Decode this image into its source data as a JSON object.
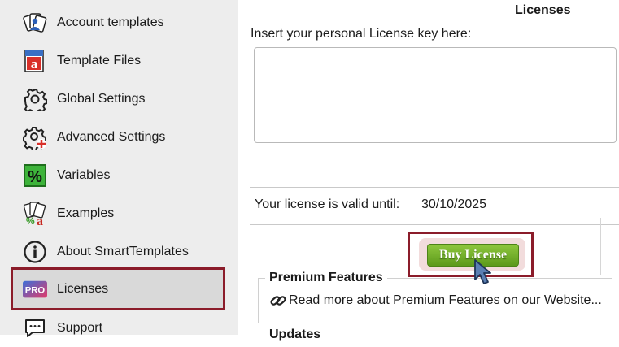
{
  "sidebar": {
    "items": [
      {
        "label": "Account templates",
        "icon": "account-templates-icon"
      },
      {
        "label": "Template Files",
        "icon": "template-files-icon"
      },
      {
        "label": "Global Settings",
        "icon": "gear-icon"
      },
      {
        "label": "Advanced Settings",
        "icon": "gear-plus-icon"
      },
      {
        "label": "Variables",
        "icon": "percent-icon"
      },
      {
        "label": "Examples",
        "icon": "examples-icon"
      },
      {
        "label": "About SmartTemplates",
        "icon": "info-icon"
      },
      {
        "label": "Licenses",
        "icon": "pro-badge-icon",
        "badge": "PRO"
      },
      {
        "label": "Support",
        "icon": "support-icon"
      }
    ],
    "selected": "Licenses"
  },
  "main": {
    "title": "Licenses",
    "prompt": "Insert your personal License key here:",
    "license_key_value": "",
    "valid_label": "Your license is valid until:",
    "valid_date": "30/10/2025",
    "buy_button": "Buy License",
    "premium": {
      "legend": "Premium Features",
      "link": "Read more about Premium Features on our Website..."
    },
    "next_legend": "Updates"
  },
  "colors": {
    "sidebar_bg": "#ededed",
    "selection_outline": "#8b1c2a",
    "buy_button_green": "#6fae27"
  }
}
